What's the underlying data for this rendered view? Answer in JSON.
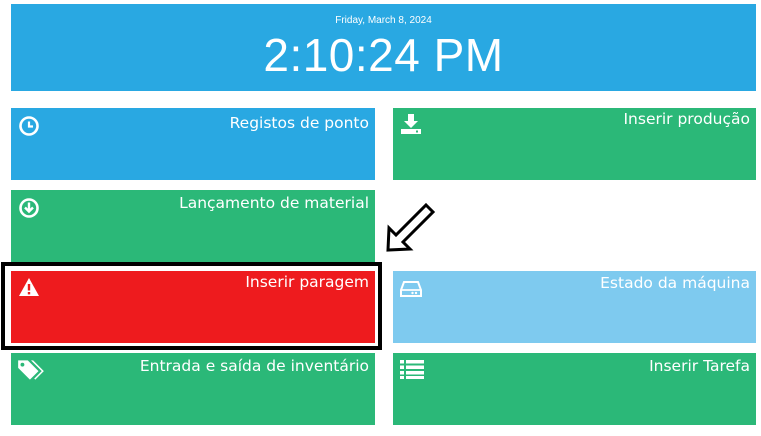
{
  "header": {
    "date": "Friday, March 8, 2024",
    "time": "2:10:24 PM"
  },
  "tiles": [
    {
      "label": "Registos de ponto",
      "icon": "clock-icon",
      "color": "#29a8e2"
    },
    {
      "label": "Inserir produção",
      "icon": "download-icon",
      "color": "#2bb878"
    },
    {
      "label": "Lançamento de material",
      "icon": "arrow-circle-down-icon",
      "color": "#2bb878"
    },
    {
      "label": "Inserir paragem",
      "icon": "warning-icon",
      "color": "#ee1b1e"
    },
    {
      "label": "Estado da máquina",
      "icon": "hard-drive-icon",
      "color": "#7ecaef"
    },
    {
      "label": "Entrada e saída de inventário",
      "icon": "tags-icon",
      "color": "#2bb878"
    },
    {
      "label": "Inserir Tarefa",
      "icon": "list-icon",
      "color": "#2bb878"
    }
  ],
  "annotations": {
    "highlight_color": "#000000",
    "arrow_icon": "pointer-arrow-icon"
  }
}
